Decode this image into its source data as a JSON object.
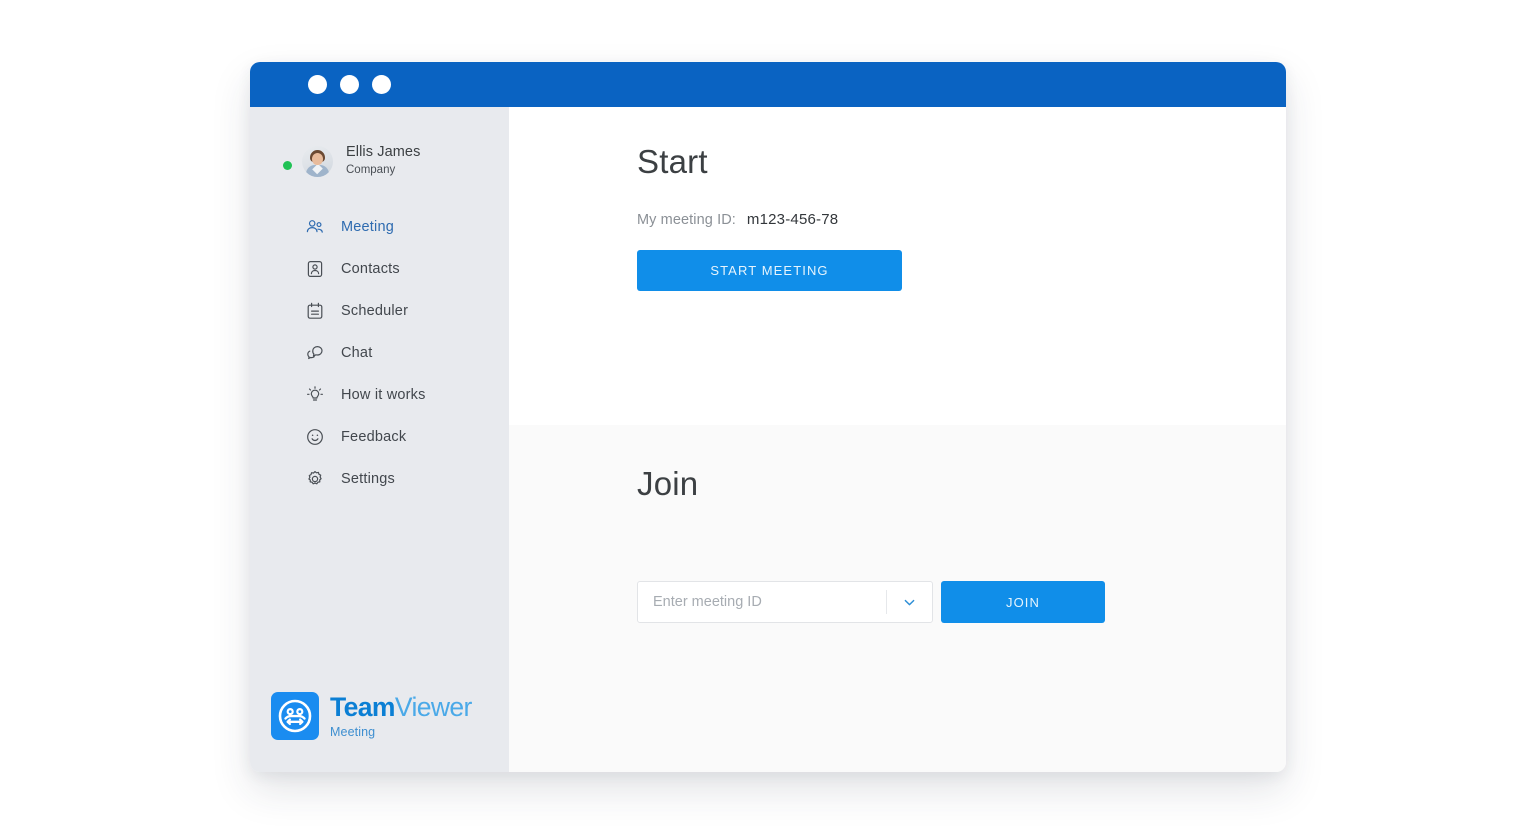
{
  "window": {
    "titlebar_dots": [
      "dot-1",
      "dot-2",
      "dot-3"
    ]
  },
  "sidebar": {
    "profile": {
      "name": "Ellis James",
      "company": "Company",
      "status": "online",
      "status_color": "#21c255"
    },
    "items": [
      {
        "label": "Meeting",
        "icon": "people-icon",
        "active": true
      },
      {
        "label": "Contacts",
        "icon": "contact-card-icon",
        "active": false
      },
      {
        "label": "Scheduler",
        "icon": "calendar-icon",
        "active": false
      },
      {
        "label": "Chat",
        "icon": "chat-bubble-icon",
        "active": false
      },
      {
        "label": "How it works",
        "icon": "lightbulb-icon",
        "active": false
      },
      {
        "label": "Feedback",
        "icon": "smiley-icon",
        "active": false
      },
      {
        "label": "Settings",
        "icon": "gear-icon",
        "active": false
      }
    ],
    "brand": {
      "word_bold": "Team",
      "word_light": "Viewer",
      "sub": "Meeting",
      "mark_icon": "teamviewer-logo-icon"
    }
  },
  "main": {
    "start": {
      "title": "Start",
      "meeting_id_label": "My meeting ID:",
      "meeting_id_value": "m123-456-78",
      "start_button": "START MEETING"
    },
    "join": {
      "title": "Join",
      "input_value": "",
      "input_placeholder": "Enter meeting ID",
      "dropdown_icon": "chevron-down-icon",
      "join_button": "JOIN"
    }
  },
  "colors": {
    "titlebar_blue": "#0a63c2",
    "accent_blue": "#108ee9",
    "sidebar_bg": "#e8eaee",
    "active_nav": "#2e6bb0",
    "online_green": "#21c255"
  }
}
